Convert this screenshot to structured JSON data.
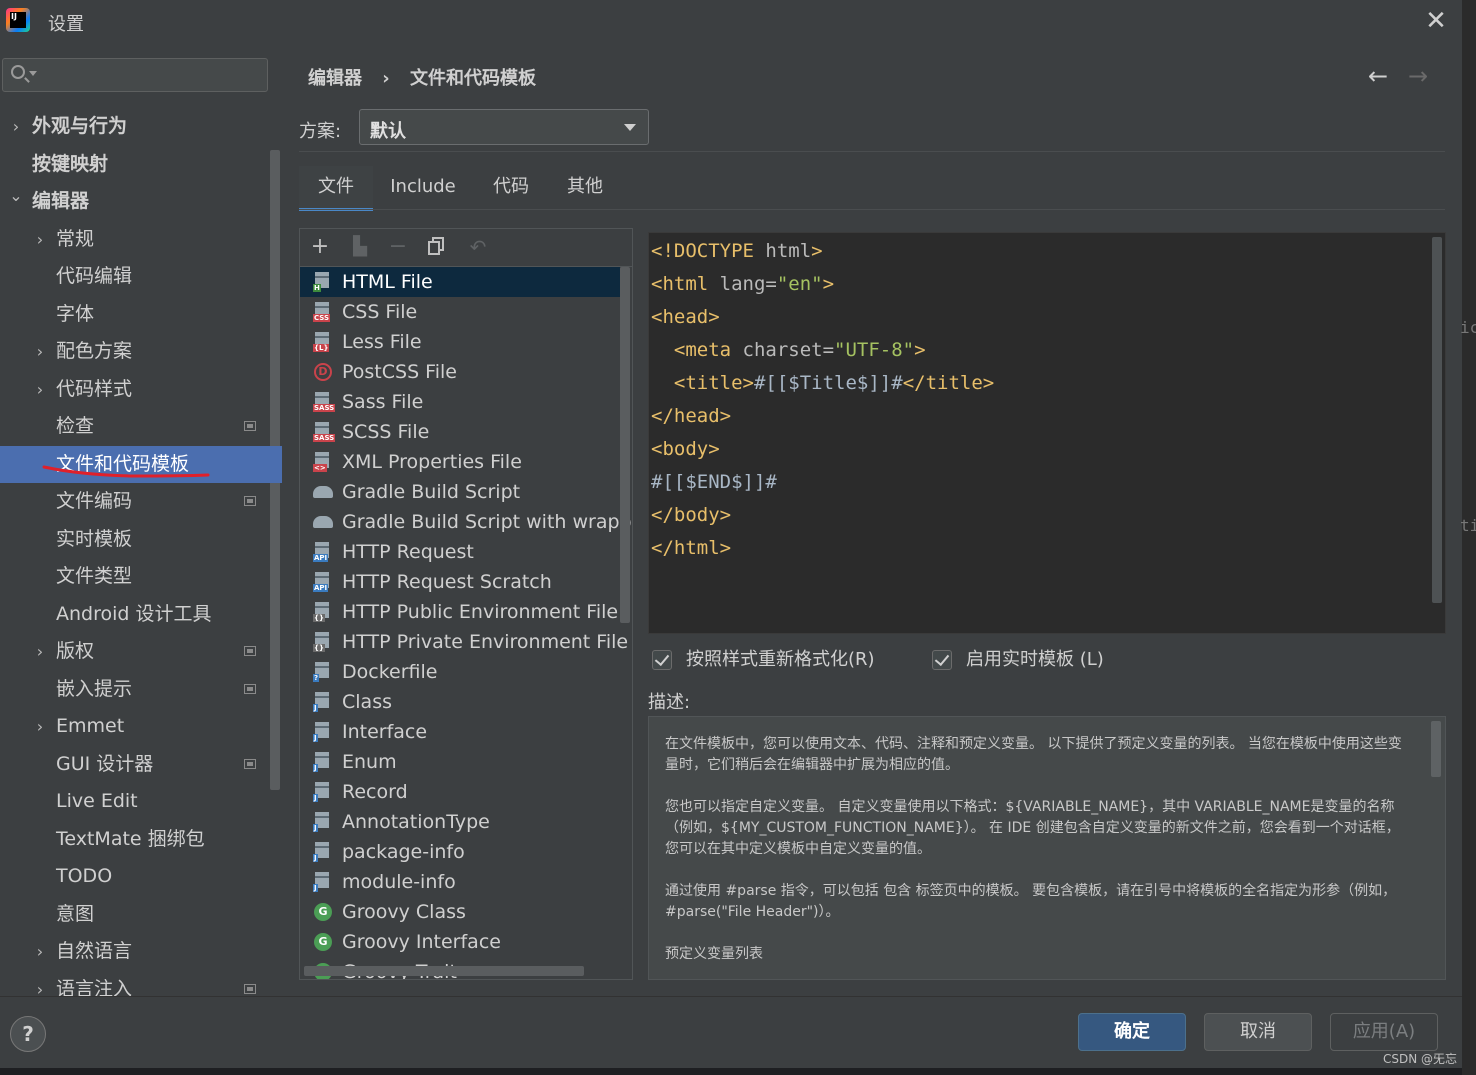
{
  "window": {
    "title": "设置",
    "app_icon_text": "IJ"
  },
  "search": {
    "placeholder": "",
    "value": ""
  },
  "sidebar": {
    "items": [
      {
        "label": "外观与行为",
        "level": 0,
        "expandable": true,
        "expanded": false,
        "bold": true
      },
      {
        "label": "按键映射",
        "level": 0,
        "expandable": false,
        "bold": true
      },
      {
        "label": "编辑器",
        "level": 0,
        "expandable": true,
        "expanded": true,
        "bold": true
      },
      {
        "label": "常规",
        "level": 1,
        "expandable": true,
        "expanded": false
      },
      {
        "label": "代码编辑",
        "level": 1
      },
      {
        "label": "字体",
        "level": 1
      },
      {
        "label": "配色方案",
        "level": 1,
        "expandable": true,
        "expanded": false
      },
      {
        "label": "代码样式",
        "level": 1,
        "expandable": true,
        "expanded": false
      },
      {
        "label": "检查",
        "level": 1,
        "project_icon": true
      },
      {
        "label": "文件和代码模板",
        "level": 1,
        "selected": true
      },
      {
        "label": "文件编码",
        "level": 1,
        "project_icon": true
      },
      {
        "label": "实时模板",
        "level": 1
      },
      {
        "label": "文件类型",
        "level": 1
      },
      {
        "label": "Android 设计工具",
        "level": 1
      },
      {
        "label": "版权",
        "level": 1,
        "expandable": true,
        "expanded": false,
        "project_icon": true
      },
      {
        "label": "嵌入提示",
        "level": 1,
        "project_icon": true
      },
      {
        "label": "Emmet",
        "level": 1,
        "expandable": true,
        "expanded": false
      },
      {
        "label": "GUI 设计器",
        "level": 1,
        "project_icon": true
      },
      {
        "label": "Live Edit",
        "level": 1
      },
      {
        "label": "TextMate 捆绑包",
        "level": 1
      },
      {
        "label": "TODO",
        "level": 1
      },
      {
        "label": "意图",
        "level": 1
      },
      {
        "label": "自然语言",
        "level": 1,
        "expandable": true,
        "expanded": false
      },
      {
        "label": "语言注入",
        "level": 1,
        "expandable": true,
        "expanded": false,
        "project_icon": true
      }
    ],
    "annotation_color": "#e0202a"
  },
  "breadcrumb": {
    "parent": "编辑器",
    "separator": "›",
    "current": "文件和代码模板"
  },
  "scheme": {
    "label": "方案:",
    "value": "默认"
  },
  "tabs": [
    "文件",
    "Include",
    "代码",
    "其他"
  ],
  "active_tab": "文件",
  "templates": {
    "toolbar_icons": [
      "add-icon",
      "add-child-icon",
      "remove-icon",
      "copy-icon",
      "reset-icon"
    ],
    "items": [
      {
        "label": "HTML File",
        "icon": "html-file-icon",
        "selected": true
      },
      {
        "label": "CSS File",
        "icon": "css-file-icon"
      },
      {
        "label": "Less File",
        "icon": "less-file-icon"
      },
      {
        "label": "PostCSS File",
        "icon": "postcss-file-icon"
      },
      {
        "label": "Sass File",
        "icon": "sass-file-icon"
      },
      {
        "label": "SCSS File",
        "icon": "scss-file-icon"
      },
      {
        "label": "XML Properties File",
        "icon": "xml-file-icon"
      },
      {
        "label": "Gradle Build Script",
        "icon": "gradle-icon"
      },
      {
        "label": "Gradle Build Script with wrapper",
        "icon": "gradle-icon"
      },
      {
        "label": "HTTP Request",
        "icon": "api-file-icon"
      },
      {
        "label": "HTTP Request Scratch",
        "icon": "api-file-icon"
      },
      {
        "label": "HTTP Public Environment File",
        "icon": "env-file-icon"
      },
      {
        "label": "HTTP Private Environment File",
        "icon": "env-file-icon"
      },
      {
        "label": "Dockerfile",
        "icon": "docker-file-icon"
      },
      {
        "label": "Class",
        "icon": "java-file-icon"
      },
      {
        "label": "Interface",
        "icon": "java-file-icon"
      },
      {
        "label": "Enum",
        "icon": "java-file-icon"
      },
      {
        "label": "Record",
        "icon": "java-file-icon"
      },
      {
        "label": "AnnotationType",
        "icon": "java-file-icon"
      },
      {
        "label": "package-info",
        "icon": "java-file-icon"
      },
      {
        "label": "module-info",
        "icon": "java-file-icon"
      },
      {
        "label": "Groovy Class",
        "icon": "groovy-icon"
      },
      {
        "label": "Groovy Interface",
        "icon": "groovy-icon"
      },
      {
        "label": "Groovy Trait",
        "icon": "groovy-icon"
      }
    ]
  },
  "editor": {
    "lines": [
      [
        {
          "t": "tag",
          "v": "<!DOCTYPE "
        },
        {
          "t": "attr",
          "v": "html"
        },
        {
          "t": "tag",
          "v": ">"
        }
      ],
      [
        {
          "t": "tag",
          "v": "<html "
        },
        {
          "t": "attr",
          "v": "lang="
        },
        {
          "t": "val",
          "v": "\"en\""
        },
        {
          "t": "tag",
          "v": ">"
        }
      ],
      [
        {
          "t": "tag",
          "v": "<head>"
        }
      ],
      [
        {
          "t": "txt",
          "v": "  "
        },
        {
          "t": "tag",
          "v": "<meta "
        },
        {
          "t": "attr",
          "v": "charset="
        },
        {
          "t": "val",
          "v": "\"UTF-8\""
        },
        {
          "t": "tag",
          "v": ">"
        }
      ],
      [
        {
          "t": "txt",
          "v": "  "
        },
        {
          "t": "tag",
          "v": "<title>"
        },
        {
          "t": "txt",
          "v": "#[[$Title$]]#"
        },
        {
          "t": "tag",
          "v": "</title>"
        }
      ],
      [
        {
          "t": "tag",
          "v": "</head>"
        }
      ],
      [
        {
          "t": "tag",
          "v": "<body>"
        }
      ],
      [
        {
          "t": "txt",
          "v": "#[[$END$]]#"
        }
      ],
      [
        {
          "t": "tag",
          "v": "</body>"
        }
      ],
      [
        {
          "t": "tag",
          "v": "</html>"
        }
      ]
    ]
  },
  "options": {
    "reformat": {
      "label": "按照样式重新格式化(R)",
      "checked": true
    },
    "live_templates": {
      "label": "启用实时模板 (L)",
      "checked": true
    }
  },
  "description": {
    "label": "描述:",
    "paragraphs": [
      "在文件模板中，您可以使用文本、代码、注释和预定义变量。 以下提供了预定义变量的列表。 当您在模板中使用这些变量时，它们稍后会在编辑器中扩展为相应的值。",
      "您也可以指定自定义变量。 自定义变量使用以下格式：${VARIABLE_NAME}，其中 VARIABLE_NAME是变量的名称（例如，${MY_CUSTOM_FUNCTION_NAME}）。 在 IDE 创建包含自定义变量的新文件之前，您会看到一个对话框，您可以在其中定义模板中自定义变量的值。",
      "通过使用 #parse 指令，可以包括 包含 标签页中的模板。 要包含模板，请在引号中将模板的全名指定为形参（例如，#parse(\"File Header\")）。",
      "预定义变量列表"
    ]
  },
  "buttons": {
    "ok": "确定",
    "cancel": "取消",
    "apply": "应用(A)",
    "help": "?"
  },
  "watermark": "CSDN @旡忘",
  "edge_text": [
    "ic",
    "ti"
  ]
}
